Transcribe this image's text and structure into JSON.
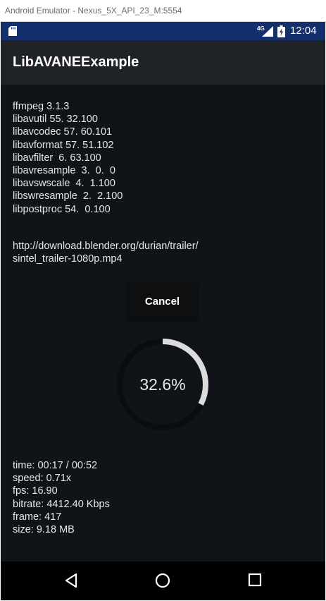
{
  "window": {
    "title": "Android Emulator - Nexus_5X_API_23_M:5554"
  },
  "status_bar": {
    "network": "4G",
    "time": "12:04",
    "sd_icon": "sd-card-icon",
    "signal_icon": "signal-icon",
    "battery_icon": "battery-icon"
  },
  "app_bar": {
    "title": "LibAVANEExample"
  },
  "versions": [
    "ffmpeg 3.1.3",
    "libavutil 55. 32.100",
    "libavcodec 57. 60.101",
    "libavformat 57. 51.102",
    "libavfilter  6. 63.100",
    "libavresample  3.  0.  0",
    "libavswscale  4.  1.100",
    "libswresample  2.  2.100",
    "libpostproc 54.  0.100"
  ],
  "url": {
    "line1": "http://download.blender.org/durian/trailer/",
    "line2": "sintel_trailer-1080p.mp4"
  },
  "cancel_label": "Cancel",
  "progress": {
    "value": 32.6,
    "label": "32.6%",
    "track_color": "#0b0c0e",
    "fill_color": "#dcdcdc"
  },
  "stats": [
    "time: 00:17 / 00:52",
    "speed: 0.71x",
    "fps: 16.90",
    "bitrate: 4412.40 Kbps",
    "frame: 417",
    "size: 9.18 MB"
  ],
  "nav": {
    "back": "back-icon",
    "home": "home-icon",
    "recents": "recents-icon"
  }
}
